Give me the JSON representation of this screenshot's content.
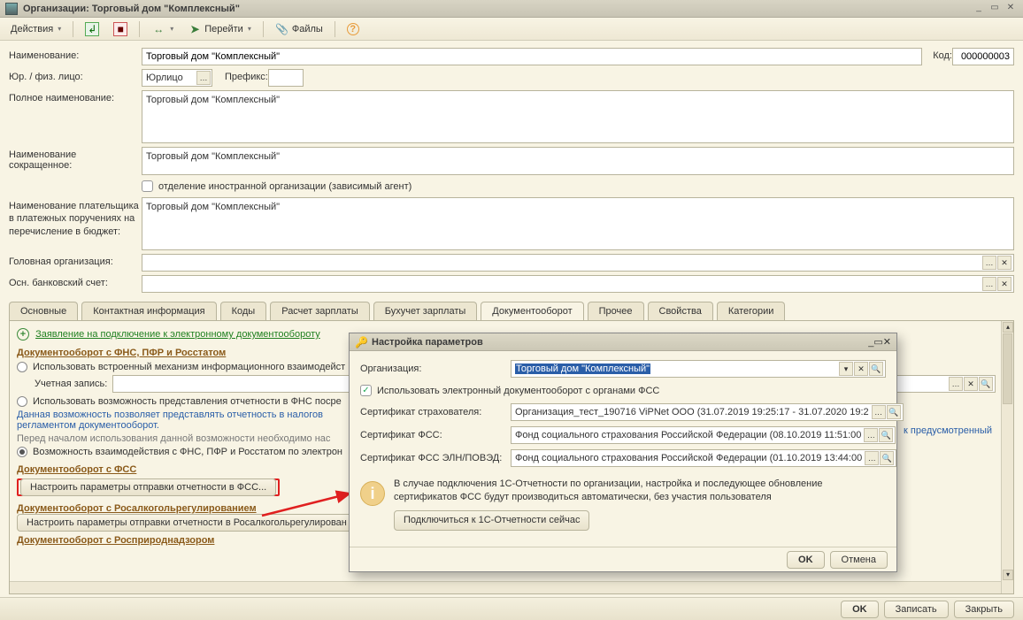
{
  "window": {
    "title": "Организации: Торговый дом \"Комплексный\""
  },
  "toolbar": {
    "actions": "Действия",
    "goto": "Перейти",
    "files": "Файлы"
  },
  "form": {
    "name_label": "Наименование:",
    "name_value": "Торговый дом \"Комплексный\"",
    "code_label": "Код:",
    "code_value": "000000003",
    "legal_label": "Юр. / физ. лицо:",
    "legal_value": "Юрлицо",
    "prefix_label": "Префикс:",
    "prefix_value": "",
    "fullname_label": "Полное наименование:",
    "fullname_value": "Торговый дом \"Комплексный\"",
    "shortname_label": "Наименование сокращенное:",
    "shortname_value": "Торговый дом \"Комплексный\"",
    "foreign_checkbox": "отделение иностранной организации (зависимый агент)",
    "payer_label": "Наименование плательщика в платежных поручениях на перечисление в бюджет:",
    "payer_value": "Торговый дом \"Комплексный\"",
    "head_org_label": "Головная организация:",
    "bank_label": "Осн. банковский счет:"
  },
  "tabs": {
    "items": [
      "Основные",
      "Контактная информация",
      "Коды",
      "Расчет зарплаты",
      "Бухучет зарплаты",
      "Документооборот",
      "Прочее",
      "Свойства",
      "Категории"
    ],
    "active": 5
  },
  "doc_tab": {
    "application_link": "Заявление на подключение к электронному документообороту",
    "section1": "Документооборот с ФНС, ПФР и Росстатом",
    "radio1": "Использовать встроенный механизм информационного взаимодейст",
    "account_label": "Учетная запись:",
    "radio2": "Использовать возможность представления отчетности в ФНС посре",
    "hint1": "Данная возможность позволяет представлять отчетность в налогов",
    "hint2": "регламентом документооборот.",
    "hint3": "Перед началом использования данной возможности необходимо нас",
    "radio3": "Возможность взаимодействия с ФНС, ПФР и Росстатом по электрон",
    "section2": "Документооборот с ФСС",
    "btn_fss": "Настроить параметры отправки отчетности в ФСС...",
    "section3": "Документооборот с Росалкогольрегулированием",
    "btn_alco": "Настроить параметры отправки отчетности в Росалкогольрегулирован",
    "section4": "Документооборот с Росприроднадзором",
    "side_hint": "к предусмотренный"
  },
  "bottom": {
    "ok": "OK",
    "write": "Записать",
    "close": "Закрыть"
  },
  "dialog": {
    "title": "Настройка параметров",
    "org_label": "Организация:",
    "org_value": "Торговый дом \"Комплексный\"",
    "use_edo": "Использовать электронный документооборот с органами ФСС",
    "cert1_label": "Сертификат страхователя:",
    "cert1_value": "Организация_тест_190716 ViPNet ООО (31.07.2019 19:25:17 - 31.07.2020 19:2",
    "cert2_label": "Сертификат ФСС:",
    "cert2_value": "Фонд социального страхования Российской Федерации (08.10.2019 11:51:00",
    "cert3_label": "Сертификат ФСС ЭЛН/ПОВЭД:",
    "cert3_value": "Фонд социального страхования Российской Федерации (01.10.2019 13:44:00",
    "info_line1": "В случае подключения 1С-Отчетности по организации, настройка и последующее обновление",
    "info_line2": "сертификатов ФСС будут производиться автоматически, без участия пользователя",
    "connect_btn": "Подключиться к 1С-Отчетности сейчас",
    "ok": "OK",
    "cancel": "Отмена"
  }
}
